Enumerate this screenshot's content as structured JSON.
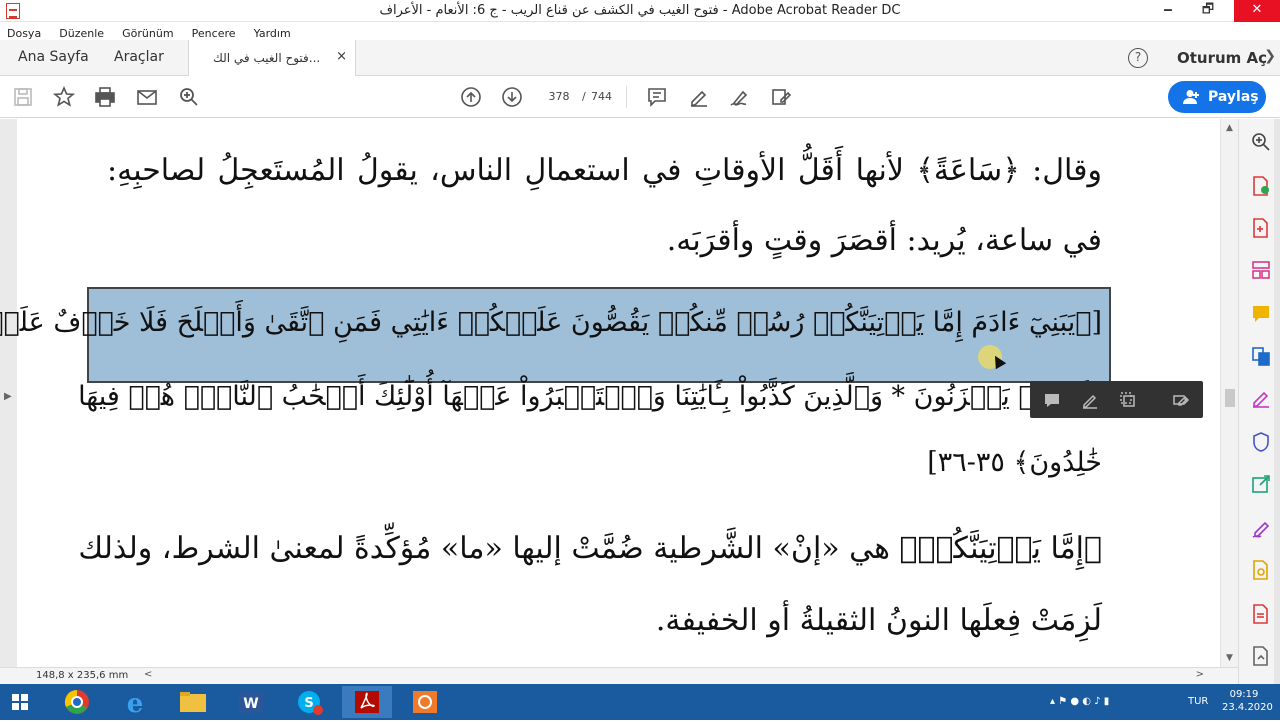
{
  "window": {
    "title": "فتوح الغيب في الكشف عن قناع الريب - ج 6: الأنعام - الأعراف - Adobe Acrobat Reader DC",
    "minimize": "🗕",
    "maximize": "🗗",
    "close": "✕"
  },
  "menu": [
    "Dosya",
    "Düzenle",
    "Görünüm",
    "Pencere",
    "Yardım"
  ],
  "tabs": {
    "home": "Ana Sayfa",
    "tools": "Araçlar",
    "document": "فتوح الغيب في الك...",
    "close": "×",
    "help": "?",
    "signin": "Oturum Aç",
    "more": "❯"
  },
  "toolbar": {
    "current_page": "378",
    "page_sep": "/",
    "total_pages": "744",
    "share_label": "Paylaş"
  },
  "document": {
    "lines": [
      "وقال: ﴿سَاعَةً﴾ لأنها أَقَلُّ الأوقاتِ في استعمالِ الناس، يقولُ المُستَعجِلُ لصاحبِهِ:",
      "في ساعة، يُريد: أقصَرَ وقتٍ وأقرَبَه.",
      "[﴿يَبَنِيٓ ءَادَمَ إِمَّا يَأۡتِيَنَّكُمۡ رُسُلٞ مِّنكُمۡ يَقُصُّونَ عَلَيۡكُمۡ ءَايَٰتِي فَمَنِ ٱتَّقَىٰ وَأَصۡلَحَ فَلَا خَوۡفٌ عَلَيۡهِمۡ",
      "وَلَا هُمۡ يَحۡزَنُونَ * وَٱلَّذِينَ كَذَّبُواْ بِـَٔايَٰتِنَا وَٱسۡتَكۡبَرُواْ عَنۡهَآ أُوْلَٰٓئِكَ أَصۡحَٰبُ ٱلنَّارِۖ هُمۡ فِيهَا",
      "خَٰلِدُونَ﴾ ٣٥-٣٦]",
      "﴿إِمَّا يَأۡتِيَنَّكُمۡ﴾ هي «إنْ» الشَّرطية ضُمَّتْ إليها «ما» مُؤكِّدةً لمعنىٰ الشرط، ولذلك",
      "لَزِمَتْ فِعلَها النونُ الثقيلةُ أو الخفيفة."
    ]
  },
  "status": {
    "dimensions": "148,8 x 235,6 mm",
    "left_arrow": "<",
    "right_arrow": ">"
  },
  "taskbar": {
    "language": "TUR",
    "time": "09:19",
    "date": "23.4.2020"
  },
  "colors": {
    "accent": "#1473e6",
    "selection": "#9fbfd9",
    "close_button": "#e81123",
    "taskbar": "#1a5a9e"
  }
}
